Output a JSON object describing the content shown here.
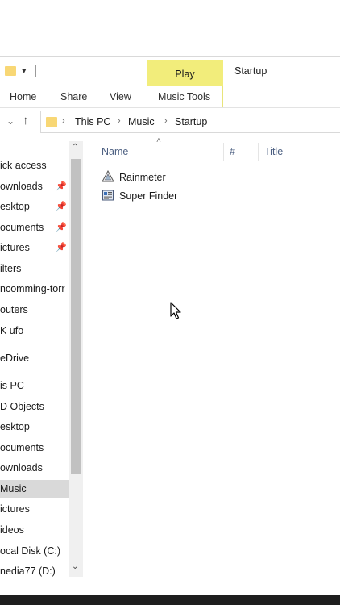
{
  "titlebar": {
    "context_tab": "Play",
    "title": "Startup"
  },
  "ribbon": {
    "tabs": [
      "Home",
      "Share",
      "View",
      "Music Tools"
    ]
  },
  "address": {
    "crumbs": [
      "This PC",
      "Music",
      "Startup"
    ]
  },
  "nav": {
    "items": [
      {
        "label": "ick access",
        "pinned": false
      },
      {
        "label": "ownloads",
        "pinned": true
      },
      {
        "label": "esktop",
        "pinned": true
      },
      {
        "label": "ocuments",
        "pinned": true
      },
      {
        "label": "ictures",
        "pinned": true
      },
      {
        "label": "ilters",
        "pinned": false
      },
      {
        "label": "ncomming-torr",
        "pinned": false
      },
      {
        "label": "outers",
        "pinned": false
      },
      {
        "label": "K ufo",
        "pinned": false
      },
      {
        "label": "eDrive",
        "pinned": false
      },
      {
        "label": "is PC",
        "pinned": false
      },
      {
        "label": "D Objects",
        "pinned": false
      },
      {
        "label": "esktop",
        "pinned": false
      },
      {
        "label": "ocuments",
        "pinned": false
      },
      {
        "label": "ownloads",
        "pinned": false
      },
      {
        "label": "Music",
        "pinned": false,
        "selected": true
      },
      {
        "label": "ictures",
        "pinned": false
      },
      {
        "label": "ideos",
        "pinned": false
      },
      {
        "label": "ocal Disk (C:)",
        "pinned": false
      },
      {
        "label": "nedia77 (D:)",
        "pinned": false
      }
    ]
  },
  "columns": [
    "Name",
    "#",
    "Title"
  ],
  "files": [
    {
      "name": "Rainmeter",
      "icon": "rainmeter-shortcut-icon"
    },
    {
      "name": "Super Finder",
      "icon": "app-shortcut-icon"
    }
  ],
  "colors": {
    "context_tab": "#f2ed7b",
    "folder": "#f8d775",
    "selected": "#d9d9d9",
    "header_text": "#4d6082"
  }
}
